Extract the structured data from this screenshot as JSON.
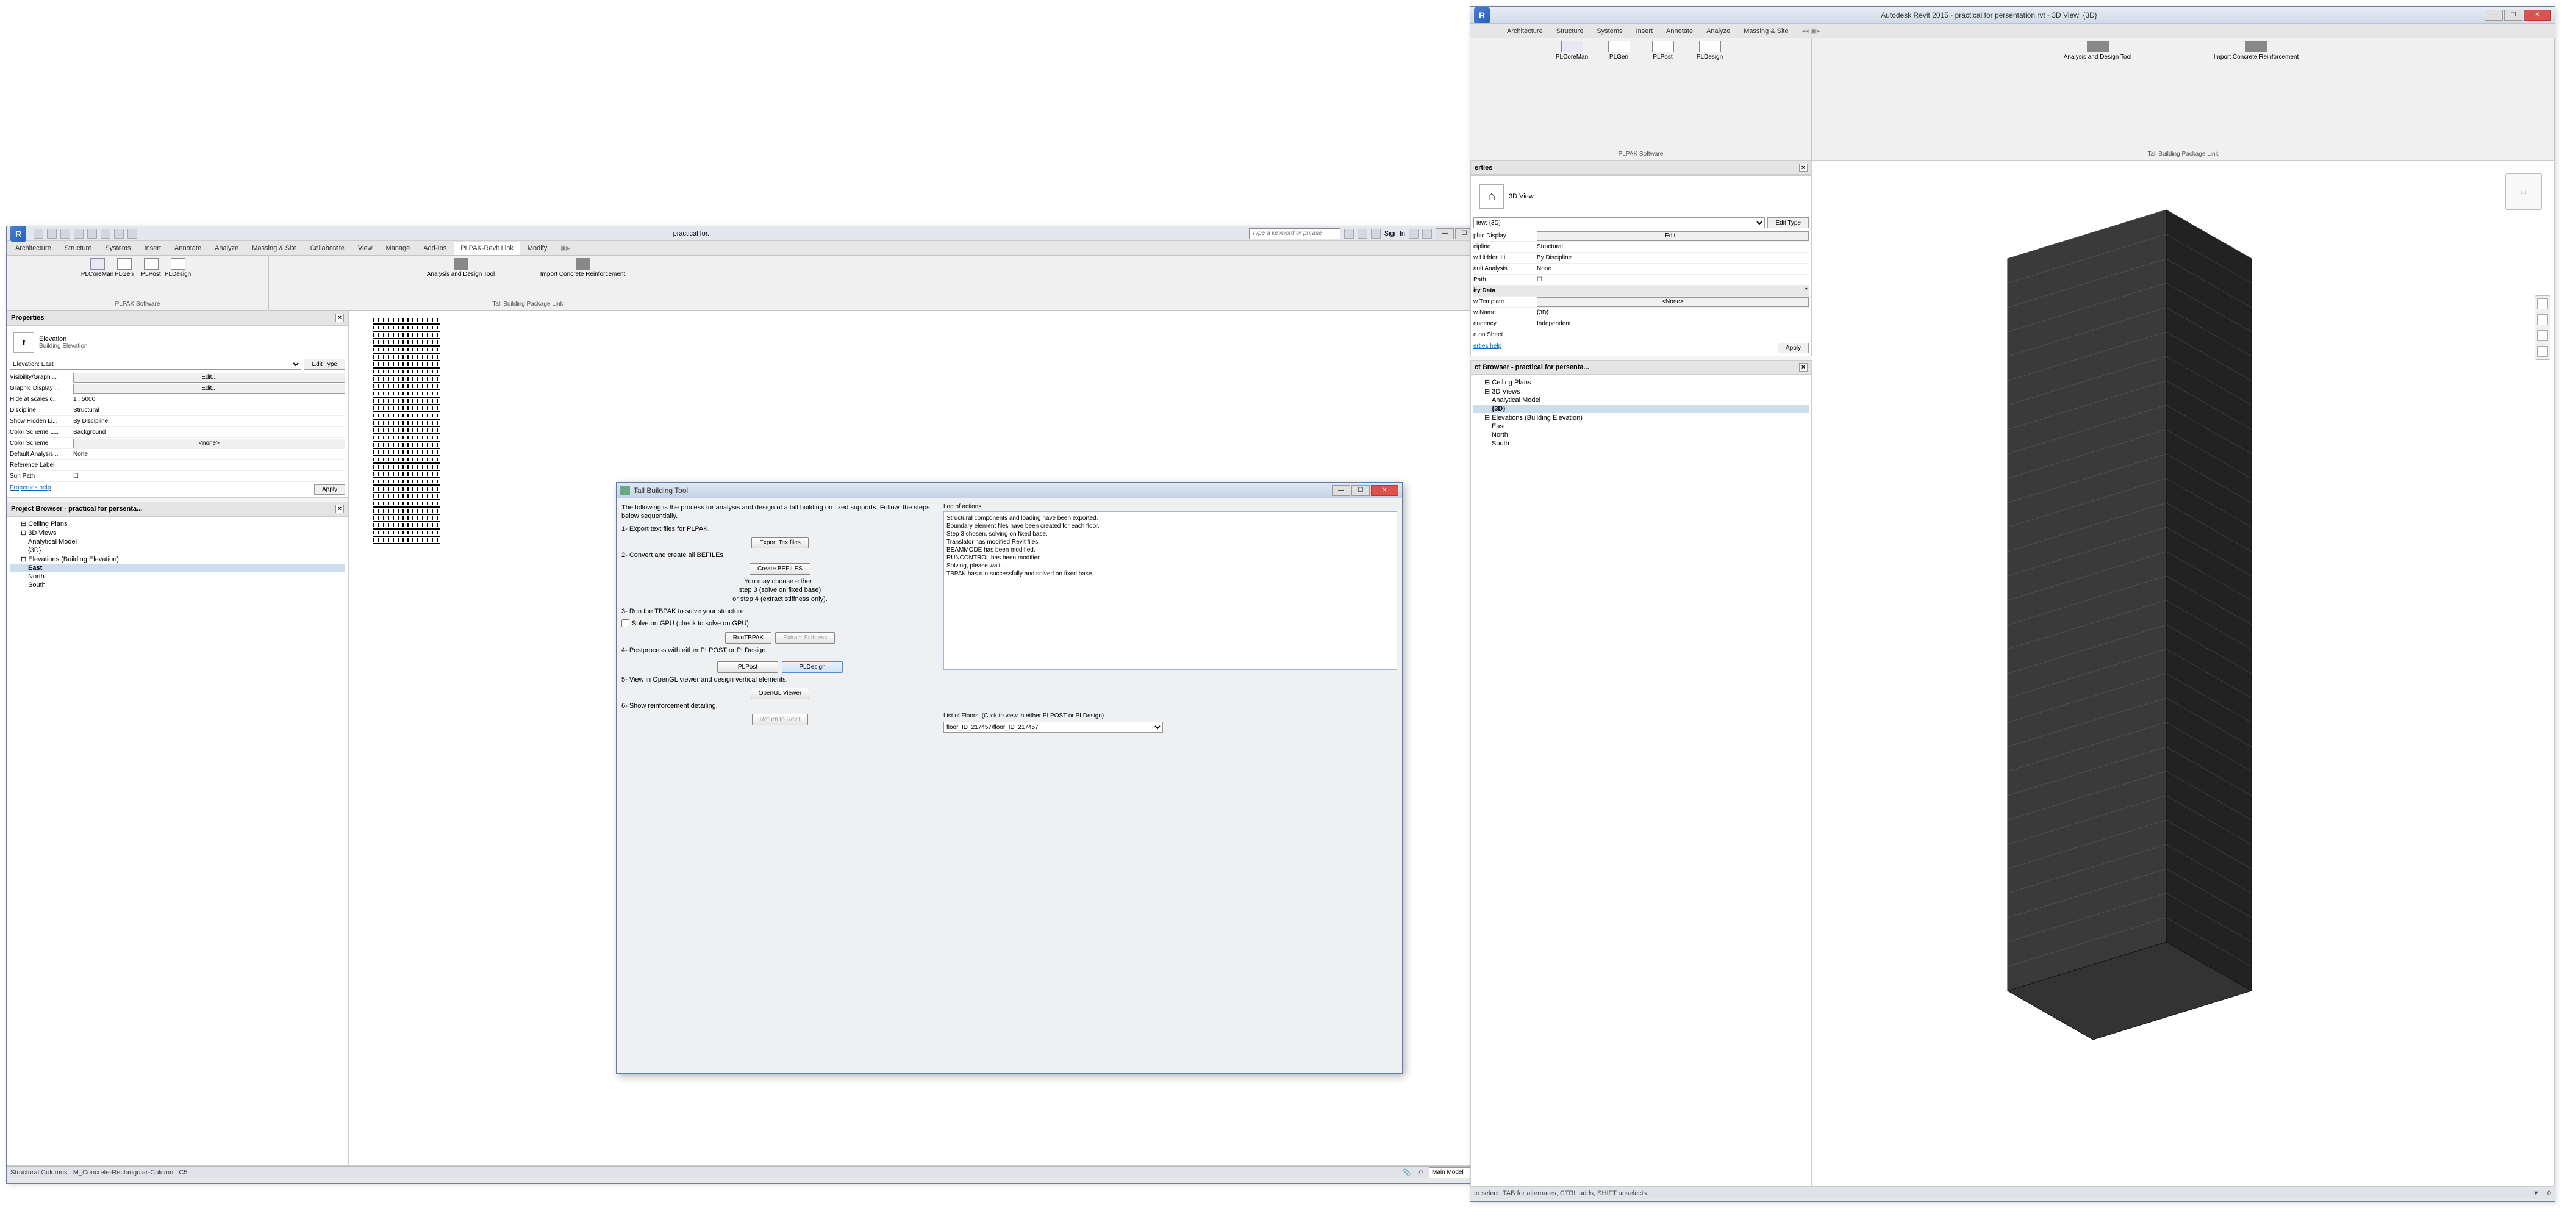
{
  "winLeft": {
    "title": "practical for...",
    "search_placeholder": "Type a keyword or phrase",
    "signin": "Sign In",
    "menu": [
      "Architecture",
      "Structure",
      "Systems",
      "Insert",
      "Annotate",
      "Analyze",
      "Massing & Site",
      "Collaborate",
      "View",
      "Manage",
      "Add-Ins",
      "PLPAK-Revit Link",
      "Modify"
    ],
    "active_menu": "PLPAK-Revit Link",
    "ribbon": {
      "panel1": {
        "title": "PLPAK Software",
        "items": [
          "PLCoreMan",
          "PLGen",
          "PLPost",
          "PLDesign"
        ]
      },
      "panel2": {
        "title": "Tall Building Package Link",
        "items": [
          "Analysis and Design Tool",
          "Import Concrete Reinforcement"
        ]
      }
    },
    "properties": {
      "title": "Properties",
      "type": "Elevation",
      "subtype": "Building Elevation",
      "selector": "Elevation: East",
      "edit_type": "Edit Type",
      "rows": [
        {
          "l": "Visibility/Graphi...",
          "btn": "Edit..."
        },
        {
          "l": "Graphic Display ...",
          "btn": "Edit..."
        },
        {
          "l": "Hide at scales c...",
          "v": "1 : 5000"
        },
        {
          "l": "Discipline",
          "v": "Structural"
        },
        {
          "l": "Show Hidden Li...",
          "v": "By Discipline"
        },
        {
          "l": "Color Scheme L...",
          "v": "Background"
        },
        {
          "l": "Color Scheme",
          "btn": "<none>"
        },
        {
          "l": "Default Analysis...",
          "v": "None"
        },
        {
          "l": "Reference Label",
          "v": ""
        },
        {
          "l": "Sun Path",
          "v": "☐"
        }
      ],
      "help": "Properties help",
      "apply": "Apply"
    },
    "browser": {
      "title": "Project Browser - practical for persenta...",
      "items": [
        {
          "t": "Ceiling Plans",
          "lv": 0
        },
        {
          "t": "3D Views",
          "lv": 0
        },
        {
          "t": "Analytical Model",
          "lv": 1
        },
        {
          "t": "{3D}",
          "lv": 1
        },
        {
          "t": "Elevations (Building Elevation)",
          "lv": 0
        },
        {
          "t": "East",
          "lv": 1,
          "sel": true
        },
        {
          "t": "North",
          "lv": 1
        },
        {
          "t": "South",
          "lv": 1
        }
      ]
    },
    "status": "Structural Columns : M_Concrete-Rectangular-Column : C5",
    "status_model": "Main Model"
  },
  "dialog": {
    "title": "Tall Building Tool",
    "intro": "The following is the process for analysis and design of a tall building on fixed supports. Follow, the steps below sequentially.",
    "step1": "1- Export text files for PLPAK.",
    "btn1": "Export Textfiles",
    "step2": "2- Convert and create all BEFILEs.",
    "btn2": "Create BEFILES",
    "note2": "You may choose either :\nstep 3 (solve on fixed base)\nor step 4 (extract stiffness only).",
    "step3": "3- Run the TBPAK to solve your structure.",
    "chk3": "Solve on GPU (check to solve on GPU)",
    "btn3a": "RunTBPAK",
    "btn3b": "Extract Stiffness",
    "step4": "4- Postprocess with either PLPOST or PLDesign.",
    "btn4a": "PLPost",
    "btn4b": "PLDesign",
    "step5": "5- View in OpenGL viewer and design vertical elements.",
    "btn5": "OpenGL Viewer",
    "step6": "6- Show reinforcement detailing.",
    "btn6": "Return to Revit",
    "log_title": "Log of actions:",
    "log": "Structural components and loading have been exported.\nBoundary element files have been created for each floor.\nStep 3 chosen, solving on fixed base.\nTranslator has modified Revit files.\nBEAMMODE has been modified.\nRUNCONTROL has been modified.\nSolving, please wait ...\nTBPAK has run successfully and solved on fixed base.",
    "floors_title": "List of Floors: (Click to view in either PLPOST or PLDesign)",
    "floors_sel": "floor_ID_217457\\floor_ID_217457"
  },
  "winRight": {
    "title": "Autodesk Revit 2015 -     practical for persentation.rvt - 3D View: {3D}",
    "menu": [
      "Architecture",
      "Structure",
      "Systems",
      "Insert",
      "Annotate",
      "Analyze",
      "Massing & Site"
    ],
    "ribbon": {
      "panel1": {
        "title": "PLPAK Software",
        "items": [
          "PLCoreMan",
          "PLGen",
          "PLPost",
          "PLDesign"
        ]
      },
      "panel2": {
        "title": "Tall Building Package Link",
        "items": [
          "Analysis and Design Tool",
          "Import Concrete Reinforcement"
        ]
      }
    },
    "properties": {
      "title": "erties",
      "type": "3D View",
      "selector": "iew: {3D}",
      "edit_type": "Edit Type",
      "rows": [
        {
          "l": "phic Display ...",
          "btn": "Edit..."
        },
        {
          "l": "cipline",
          "v": "Structural"
        },
        {
          "l": "w Hidden Li...",
          "v": "By Discipline"
        },
        {
          "l": "ault Analysis...",
          "v": "None"
        },
        {
          "l": "Path",
          "v": "☐"
        }
      ],
      "section": "ity Data",
      "rows2": [
        {
          "l": "w Template",
          "btn": "<None>"
        },
        {
          "l": "w Name",
          "v": "{3D}"
        },
        {
          "l": "endency",
          "v": "Independent"
        },
        {
          "l": "e on Sheet",
          "v": ""
        }
      ],
      "help": "erties help",
      "apply": "Apply"
    },
    "browser": {
      "title": "ct Browser - practical for persenta...",
      "items": [
        {
          "t": "Ceiling Plans",
          "lv": 0
        },
        {
          "t": "3D Views",
          "lv": 0
        },
        {
          "t": "Analytical Model",
          "lv": 1
        },
        {
          "t": "{3D}",
          "lv": 1,
          "sel": true
        },
        {
          "t": "Elevations (Building Elevation)",
          "lv": 0
        },
        {
          "t": "East",
          "lv": 1
        },
        {
          "t": "North",
          "lv": 1
        },
        {
          "t": "South",
          "lv": 1
        }
      ]
    },
    "status": "to select, TAB for alternates, CTRL adds, SHIFT unselects.",
    "status_count": ":0"
  }
}
